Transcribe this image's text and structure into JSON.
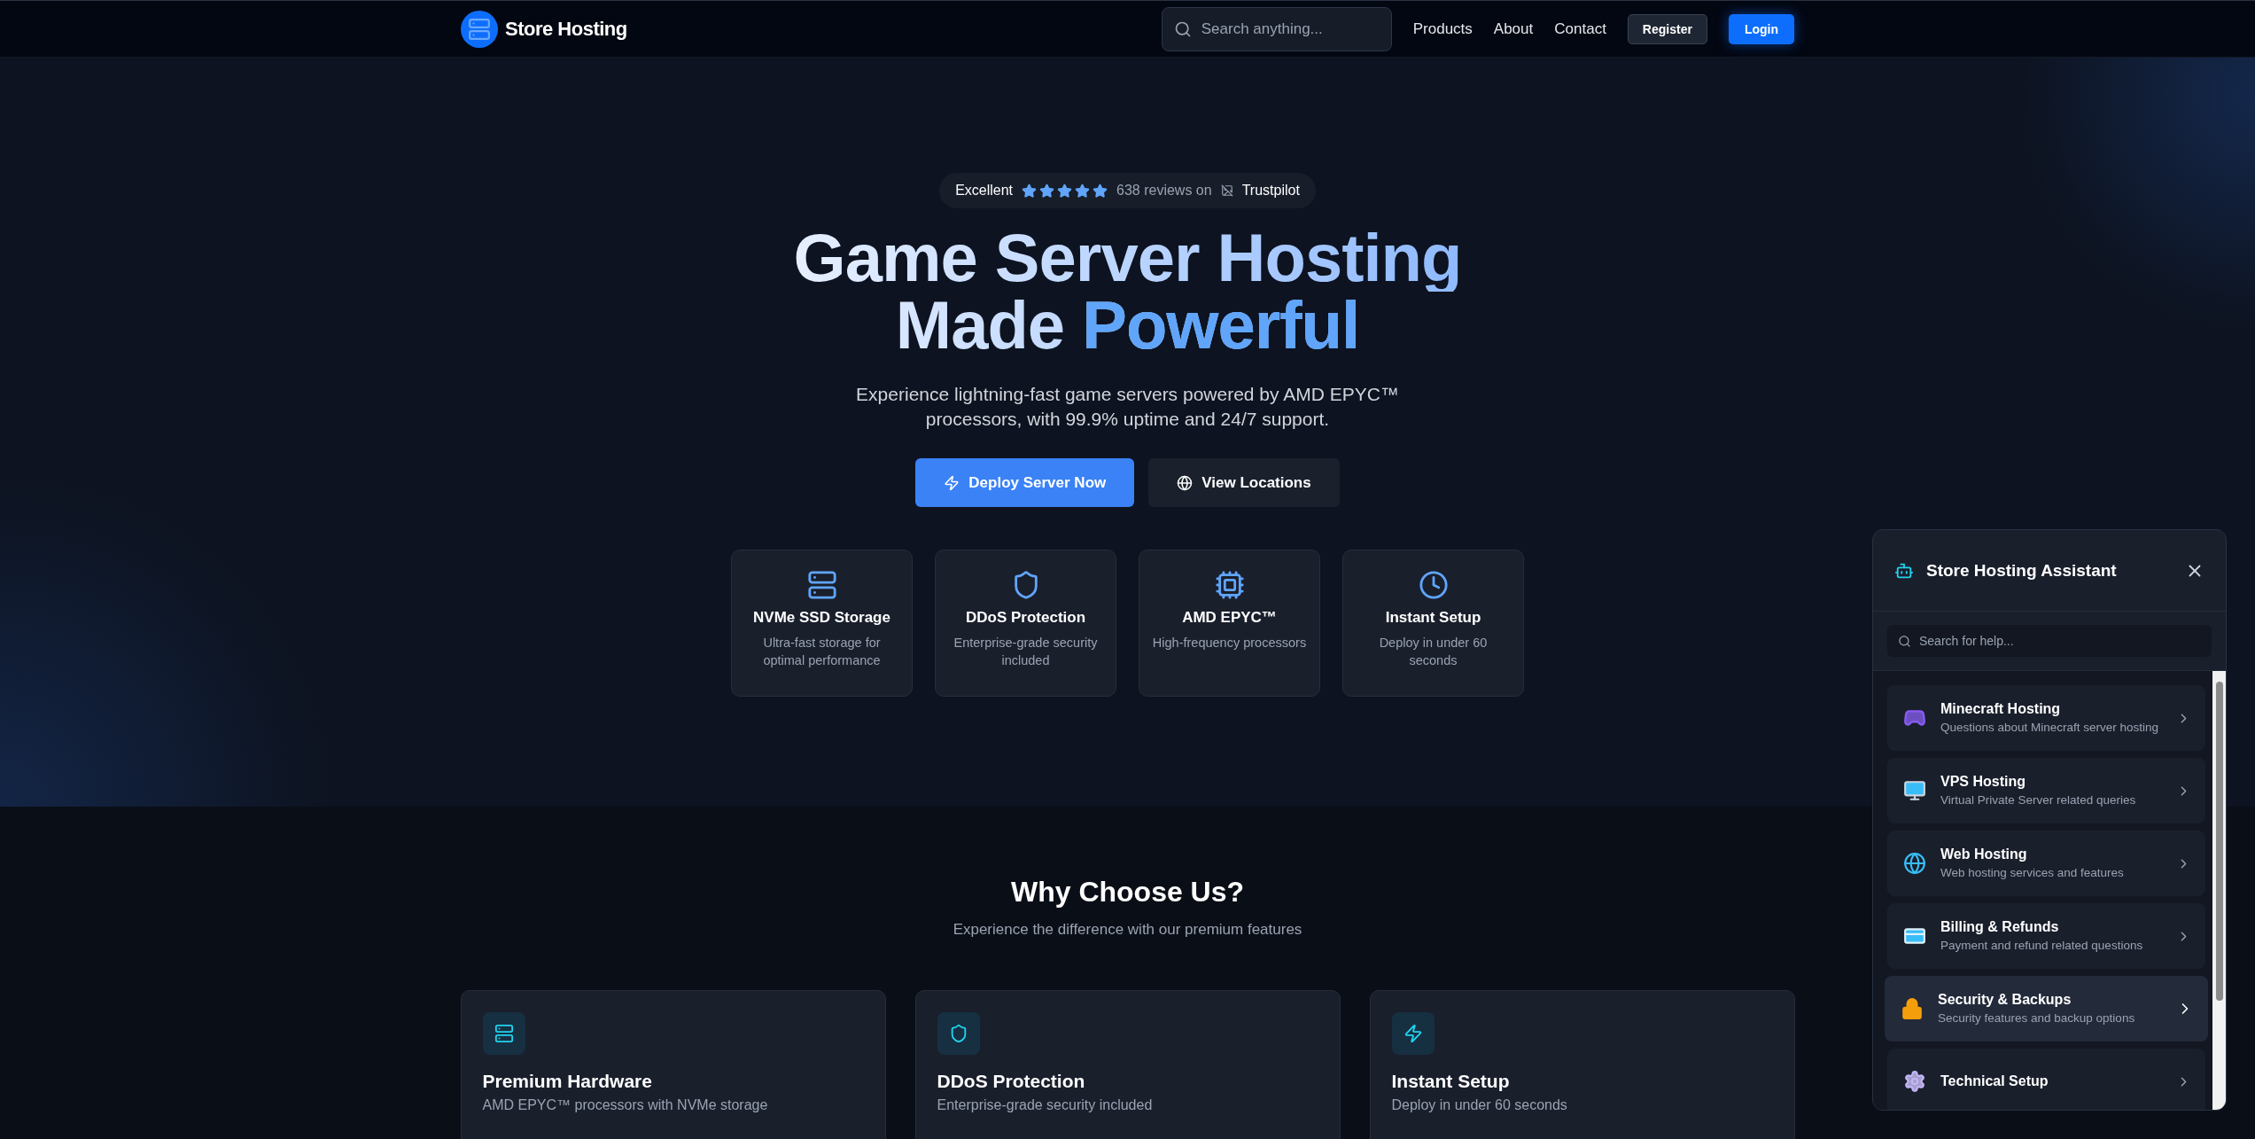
{
  "nav": {
    "brand": "Store Hosting",
    "search_placeholder": "Search anything...",
    "links": [
      "Products",
      "About",
      "Contact"
    ],
    "register": "Register",
    "login": "Login"
  },
  "hero": {
    "rating": {
      "label": "Excellent",
      "stars": 5,
      "reviews": "638 reviews on",
      "trustpilot": "Trustpilot"
    },
    "title_line1": "Game Server Hosting",
    "title_line2_plain": "Made",
    "title_line2_accent": "Powerful",
    "subtitle": "Experience lightning-fast game servers powered by AMD EPYC™ processors, with 99.9% uptime and 24/7 support.",
    "primary_button": "Deploy Server Now",
    "secondary_button": "View Locations",
    "features": [
      {
        "kind": "server",
        "title": "NVMe SSD Storage",
        "text": "Ultra-fast storage for optimal performance"
      },
      {
        "kind": "shield",
        "title": "DDoS Protection",
        "text": "Enterprise-grade security included"
      },
      {
        "kind": "cpu",
        "title": "AMD EPYC™",
        "text": "High-frequency processors"
      },
      {
        "kind": "clock",
        "title": "Instant Setup",
        "text": "Deploy in under 60 seconds"
      }
    ]
  },
  "why": {
    "title": "Why Choose Us?",
    "subtitle": "Experience the difference with our premium features",
    "cards": [
      {
        "kind": "server",
        "title": "Premium Hardware",
        "text": "AMD EPYC™ processors with NVMe storage"
      },
      {
        "kind": "shield",
        "title": "DDoS Protection",
        "text": "Enterprise-grade security included"
      },
      {
        "kind": "zap",
        "title": "Instant Setup",
        "text": "Deploy in under 60 seconds"
      }
    ]
  },
  "assistant": {
    "title": "Store Hosting Assistant",
    "search_placeholder": "Search for help...",
    "topics": [
      {
        "kind": "gamepad",
        "title": "Minecraft Hosting",
        "text": "Questions about Minecraft server hosting",
        "selected": false
      },
      {
        "kind": "monitor",
        "title": "VPS Hosting",
        "text": "Virtual Private Server related queries",
        "selected": false
      },
      {
        "kind": "globe",
        "title": "Web Hosting",
        "text": "Web hosting services and features",
        "selected": false
      },
      {
        "kind": "card",
        "title": "Billing & Refunds",
        "text": "Payment and refund related questions",
        "selected": false
      },
      {
        "kind": "lock",
        "title": "Security & Backups",
        "text": "Security features and backup options",
        "selected": true
      },
      {
        "kind": "gear",
        "title": "Technical Setup",
        "selected": false
      }
    ]
  }
}
